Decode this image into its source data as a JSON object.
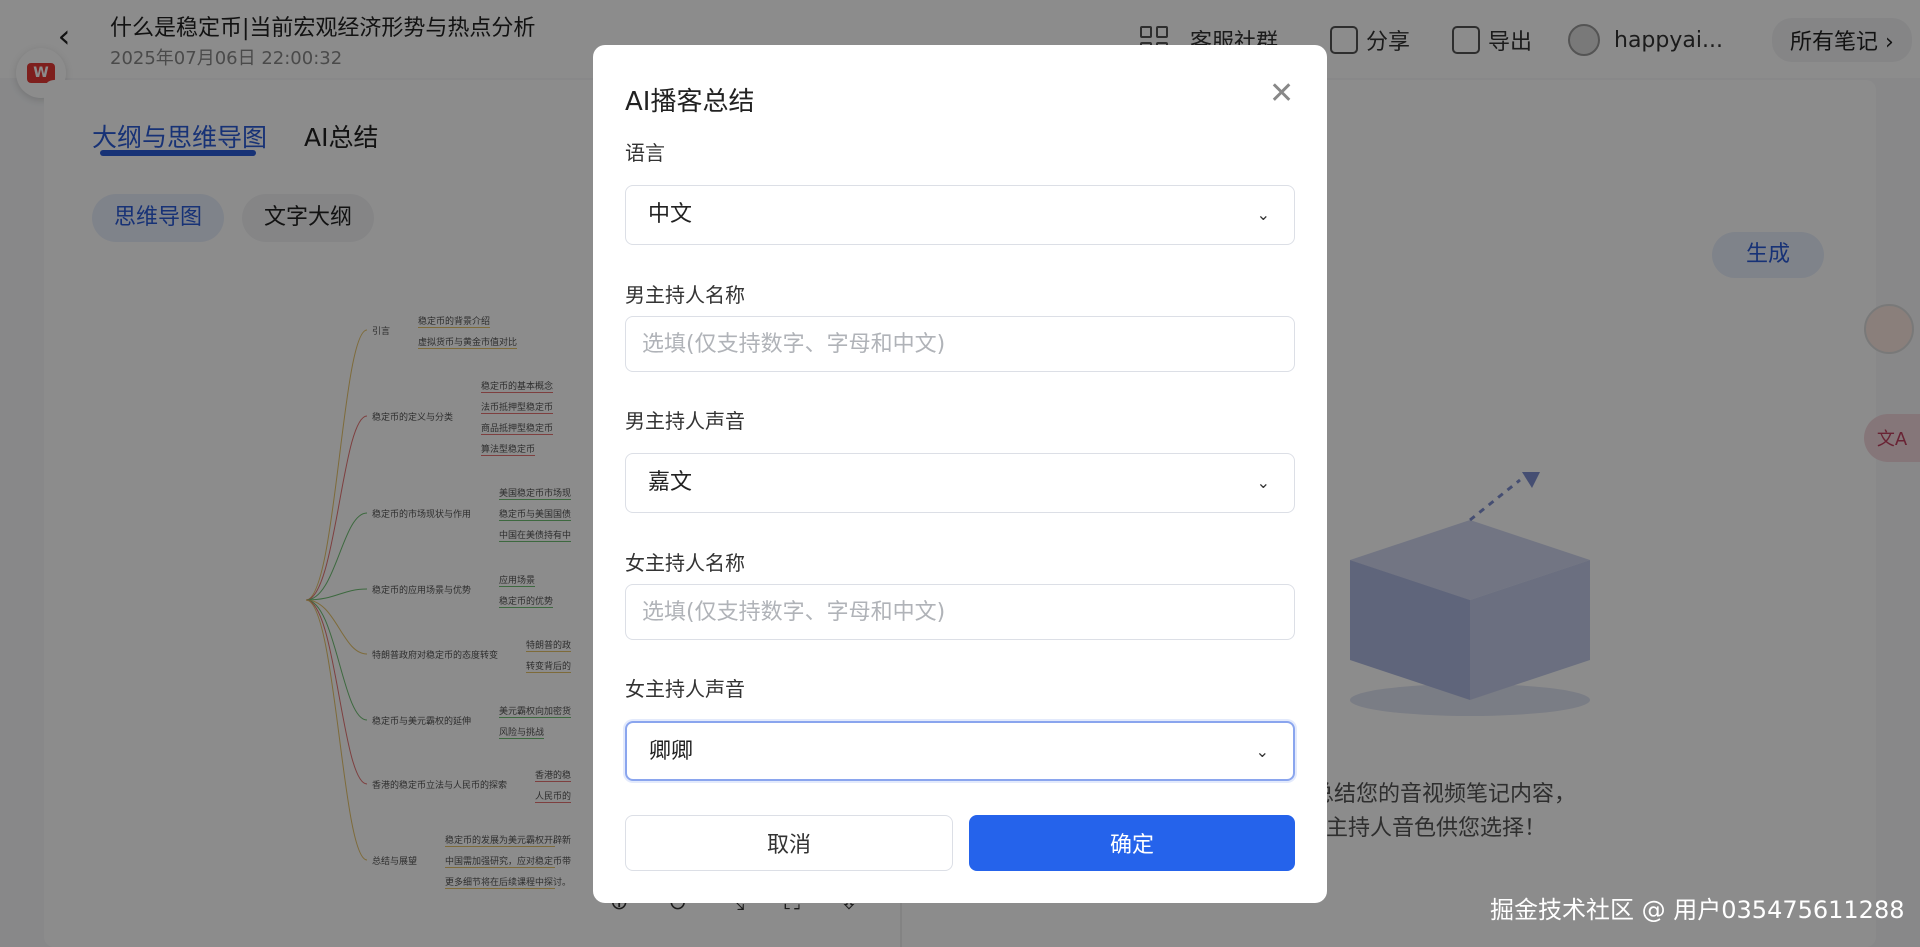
{
  "header": {
    "back_icon": "chevron-left-icon",
    "title": "什么是稳定币|当前宏观经济形势与热点分析",
    "date": "2025年07月06日 22:00:32",
    "community_label": "客服社群",
    "share_label": "分享",
    "export_label": "导出",
    "username": "happyai...",
    "all_notes_label": "所有笔记"
  },
  "tabs": [
    {
      "label": "大纲与思维导图",
      "active": true
    },
    {
      "label": "AI总结",
      "active": false
    }
  ],
  "view_toggle": {
    "mindmap": "思维导图",
    "outline": "文字大纲"
  },
  "generate_label": "生成",
  "mindmap": {
    "branches": [
      {
        "label": "引言",
        "children": [
          "稳定币的背景介绍",
          "虚拟货币与黄金市值对比"
        ]
      },
      {
        "label": "稳定币的定义与分类",
        "children": [
          "稳定币的基本概念",
          "法币抵押型稳定币",
          "商品抵押型稳定币",
          "算法型稳定币"
        ]
      },
      {
        "label": "稳定币的市场现状与作用",
        "children": [
          "美国稳定币市场现",
          "稳定币与美国国债",
          "中国在美债持有中"
        ]
      },
      {
        "label": "稳定币的应用场景与优势",
        "children": [
          "应用场景",
          "稳定币的优势"
        ]
      },
      {
        "label": "特朗普政府对稳定币的态度转变",
        "children": [
          "特朗普的政",
          "转变背后的"
        ]
      },
      {
        "label": "稳定币与美元霸权的延伸",
        "children": [
          "美元霸权向加密货",
          "风险与挑战"
        ]
      },
      {
        "label": "香港的稳定币立法与人民币的探索",
        "children": [
          "香港的稳",
          "人民币的"
        ]
      },
      {
        "label": "总结与展望",
        "children": [
          "稳定币的发展为美元霸权开辟新",
          "中国需加强研究，应对稳定币带",
          "更多细节将在后续课程中探讨。"
        ]
      }
    ]
  },
  "empty_state": {
    "line1": "客总结您的音视频笔记内容，",
    "line2": "主持人音色供您选择！"
  },
  "watermark": "掘金技术社区 @ 用户035475611288",
  "modal": {
    "title": "AI播客总结",
    "close_icon": "close-icon",
    "language_label": "语言",
    "language_value": "中文",
    "male_name_label": "男主持人名称",
    "male_name_placeholder": "选填(仅支持数字、字母和中文)",
    "male_voice_label": "男主持人声音",
    "male_voice_value": "嘉文",
    "female_name_label": "女主持人名称",
    "female_name_placeholder": "选填(仅支持数字、字母和中文)",
    "female_voice_label": "女主持人声音",
    "female_voice_value": "卿卿",
    "cancel_label": "取消",
    "confirm_label": "确定"
  }
}
